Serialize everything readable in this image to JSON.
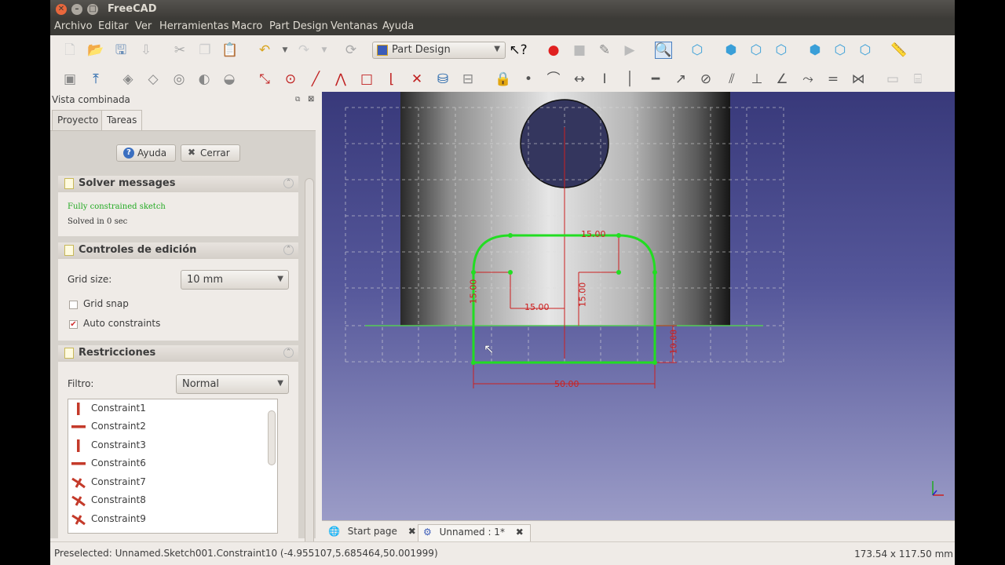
{
  "window": {
    "title": "FreeCAD"
  },
  "menu": [
    "Archivo",
    "Editar",
    "Ver",
    "Herramientas",
    "Macro",
    "Part Design",
    "Ventanas",
    "Ayuda"
  ],
  "toolbar": {
    "workbench": "Part Design"
  },
  "combo_view": {
    "title": "Vista combinada",
    "tabs": [
      "Proyecto",
      "Tareas"
    ],
    "active_tab": "Tareas",
    "help_button": "Ayuda",
    "close_button": "Cerrar",
    "solver": {
      "title": "Solver messages",
      "status": "Fully constrained sketch",
      "time": "Solved in 0 sec",
      "status_color": "#22aa22"
    },
    "edit_controls": {
      "title": "Controles de edición",
      "grid_size_label": "Grid size:",
      "grid_size_value": "10 mm",
      "grid_snap_label": "Grid snap",
      "grid_snap_checked": false,
      "auto_constraints_label": "Auto constraints",
      "auto_constraints_checked": true
    },
    "constraints": {
      "title": "Restricciones",
      "filter_label": "Filtro:",
      "filter_value": "Normal",
      "items": [
        {
          "name": "Constraint1",
          "icon": "vertical-constraint-icon"
        },
        {
          "name": "Constraint2",
          "icon": "horizontal-constraint-icon"
        },
        {
          "name": "Constraint3",
          "icon": "vertical-constraint-icon"
        },
        {
          "name": "Constraint6",
          "icon": "horizontal-constraint-icon"
        },
        {
          "name": "Constraint7",
          "icon": "tangent-constraint-icon"
        },
        {
          "name": "Constraint8",
          "icon": "tangent-constraint-icon"
        },
        {
          "name": "Constraint9",
          "icon": "tangent-constraint-icon"
        }
      ]
    }
  },
  "sketch": {
    "dim_top": "15.00",
    "dim_mid": "15.00",
    "dim_left": "15.00",
    "dim_right": "15.00",
    "dim_height": "10.00",
    "dim_bottom": "50.00",
    "sketch_color": "#22dd22",
    "dimension_color": "#cc2020",
    "background_top": "#38397a",
    "background_bottom": "#9b9cc7"
  },
  "view_tabs": [
    "Start page",
    "Unnamed : 1*"
  ],
  "status": {
    "message": "Preselected: Unnamed.Sketch001.Constraint10 (-4.955107,5.685464,50.001999)",
    "dimensions": "173.54 x 117.50 mm"
  }
}
